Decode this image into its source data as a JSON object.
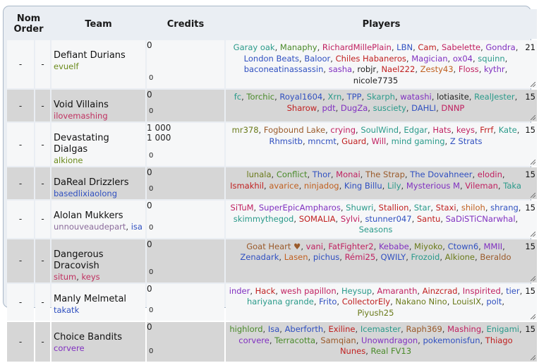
{
  "headers": {
    "nom": "Nom",
    "order": "Order",
    "team": "Team",
    "credits": "Credits",
    "players": "Players"
  },
  "colors": {
    "green": "#4a8a2a",
    "pink": "#c03060",
    "teal": "#2a9a8a",
    "blue": "#3050c0",
    "red": "#c02020",
    "brown": "#9a5a2a",
    "purple": "#8030c0",
    "olive": "#6a7a1a"
  },
  "rows": [
    {
      "nom": "-",
      "order": "-",
      "team": "Defiant Durians",
      "managers": [
        {
          "name": "evuelf",
          "color": "#6a8a1a"
        }
      ],
      "credits": "0",
      "credits_sub": "",
      "credits_left": "0",
      "count": "21",
      "height": 59,
      "players": [
        {
          "n": "Garay oak",
          "c": "#2a9a8a"
        },
        {
          "n": "Manaphy",
          "c": "#4a8a2a"
        },
        {
          "n": "RichardMillePlain",
          "c": "#c02060"
        },
        {
          "n": "LBN",
          "c": "#3050c0"
        },
        {
          "n": "Cam",
          "c": "#c02020"
        },
        {
          "n": "Sabelette",
          "c": "#c02060"
        },
        {
          "n": "Gondra",
          "c": "#8030c0"
        },
        {
          "n": "London Beats",
          "c": "#3050c0"
        },
        {
          "n": "Baloor",
          "c": "#3050c0"
        },
        {
          "n": "Chiles Habaneros",
          "c": "#c02020"
        },
        {
          "n": "Magician",
          "c": "#8030c0"
        },
        {
          "n": "ox04",
          "c": "#8030c0"
        },
        {
          "n": "squinn",
          "c": "#2a9a8a"
        },
        {
          "n": "baconeatinassassin",
          "c": "#3050c0"
        },
        {
          "n": "sasha",
          "c": "#8030c0"
        },
        {
          "n": "robjr",
          "c": "#222222"
        },
        {
          "n": "Nael222",
          "c": "#c02020"
        },
        {
          "n": "Zesty43",
          "c": "#c06020"
        },
        {
          "n": "Floss",
          "c": "#c02060"
        },
        {
          "n": "kythr",
          "c": "#8030c0"
        },
        {
          "n": "nicole7735",
          "c": "#222222"
        }
      ]
    },
    {
      "nom": "-",
      "order": "-",
      "team": "Void Villains",
      "managers": [
        {
          "name": "ilovemashing",
          "color": "#c03060"
        }
      ],
      "credits": "0",
      "credits_sub": "",
      "credits_left": "0",
      "count": "15",
      "height": 37,
      "players": [
        {
          "n": "fc",
          "c": "#2a9a8a"
        },
        {
          "n": "Torchic",
          "c": "#4a8a2a"
        },
        {
          "n": "Royal1604",
          "c": "#3050c0"
        },
        {
          "n": "Xrn",
          "c": "#2a9a8a"
        },
        {
          "n": "TPP",
          "c": "#3050c0"
        },
        {
          "n": "Skarph",
          "c": "#2a9a8a"
        },
        {
          "n": "watashi",
          "c": "#8030c0"
        },
        {
          "n": "lotiasite",
          "c": "#222222"
        },
        {
          "n": "RealJester",
          "c": "#2a9a8a"
        },
        {
          "n": "Sharow",
          "c": "#c02020"
        },
        {
          "n": "pdt",
          "c": "#8030c0"
        },
        {
          "n": "DugZa",
          "c": "#8030c0"
        },
        {
          "n": "susciety",
          "c": "#2a9a8a"
        },
        {
          "n": "DAHLI",
          "c": "#3050c0"
        },
        {
          "n": "DNNP",
          "c": "#c02060"
        }
      ]
    },
    {
      "nom": "-",
      "order": "-",
      "team": "Devastating Dialgas",
      "managers": [
        {
          "name": "alkione",
          "color": "#6a8a1a"
        }
      ],
      "credits": "1 000",
      "credits_sub": "1 000",
      "credits_left": "0",
      "count": "15",
      "height": 41,
      "players": [
        {
          "n": "mr378",
          "c": "#6a7a1a"
        },
        {
          "n": "Fogbound Lake",
          "c": "#9a5a2a"
        },
        {
          "n": "crying",
          "c": "#c02060"
        },
        {
          "n": "SoulWind",
          "c": "#2a9a8a"
        },
        {
          "n": "Edgar",
          "c": "#2a9a8a"
        },
        {
          "n": "Hats",
          "c": "#c02060"
        },
        {
          "n": "keys",
          "c": "#c02060"
        },
        {
          "n": "Frrf",
          "c": "#c02020"
        },
        {
          "n": "Kate",
          "c": "#2a9a8a"
        },
        {
          "n": "Rhmsitb",
          "c": "#3050c0"
        },
        {
          "n": "mncmt",
          "c": "#3050c0"
        },
        {
          "n": "Guard",
          "c": "#c02020"
        },
        {
          "n": "Will",
          "c": "#c02060"
        },
        {
          "n": "mind gaming",
          "c": "#2a9a8a"
        },
        {
          "n": "Z Strats",
          "c": "#3050c0"
        }
      ]
    },
    {
      "nom": "-",
      "order": "-",
      "team": "DaReal Drizzlers",
      "managers": [
        {
          "name": "basedlixiaolong",
          "color": "#3050c0"
        }
      ],
      "credits": "0",
      "credits_sub": "",
      "credits_left": "0",
      "count": "15",
      "height": 42,
      "players": [
        {
          "n": "lunala",
          "c": "#6a7a1a"
        },
        {
          "n": "Conflict",
          "c": "#4a8a2a"
        },
        {
          "n": "Thor",
          "c": "#3050c0"
        },
        {
          "n": "Monai",
          "c": "#c02060"
        },
        {
          "n": "The Strap",
          "c": "#9a5a2a"
        },
        {
          "n": "The Dovahneer",
          "c": "#3050c0"
        },
        {
          "n": "elodin",
          "c": "#c02060"
        },
        {
          "n": "Ismakhil",
          "c": "#c02020"
        },
        {
          "n": "avarice",
          "c": "#c06020"
        },
        {
          "n": "ninjadog",
          "c": "#c06020"
        },
        {
          "n": "King Billu",
          "c": "#3050c0"
        },
        {
          "n": "Lily",
          "c": "#2a9a8a"
        },
        {
          "n": "Mysterious M",
          "c": "#8030c0"
        },
        {
          "n": "Vileman",
          "c": "#c02060"
        },
        {
          "n": "Taka",
          "c": "#2a9a8a"
        }
      ]
    },
    {
      "nom": "-",
      "order": "-",
      "team": "Alolan Mukkers",
      "managers": [
        {
          "name": "unnouveaudepart",
          "color": "#8a6a9a"
        },
        {
          "name": "isa",
          "color": "#3050c0"
        }
      ],
      "credits": "0",
      "credits_sub": "",
      "credits_left": "0",
      "count": "15",
      "height": 43,
      "players": [
        {
          "n": "SiTuM",
          "c": "#c02060"
        },
        {
          "n": "SuperEpicAmpharos",
          "c": "#8030c0"
        },
        {
          "n": "Shuwri",
          "c": "#2a9a8a"
        },
        {
          "n": "Stallion",
          "c": "#c02020"
        },
        {
          "n": "Star",
          "c": "#2a9a8a"
        },
        {
          "n": "Staxi",
          "c": "#c02020"
        },
        {
          "n": "shiloh",
          "c": "#c06020"
        },
        {
          "n": "shrang",
          "c": "#3050c0"
        },
        {
          "n": "skimmythegod",
          "c": "#2a9a8a"
        },
        {
          "n": "SOMALIA",
          "c": "#c02020"
        },
        {
          "n": "Sylvi",
          "c": "#c02060"
        },
        {
          "n": "stunner047",
          "c": "#3050c0"
        },
        {
          "n": "Santu",
          "c": "#c02020"
        },
        {
          "n": "SaDiSTiCNarwhal",
          "c": "#8030c0"
        },
        {
          "n": "Seasons",
          "c": "#2a9a8a"
        }
      ]
    },
    {
      "nom": "-",
      "order": "-",
      "team": "Dangerous Dracovish",
      "managers": [
        {
          "name": "situm",
          "color": "#c03060"
        },
        {
          "name": "keys",
          "color": "#c03060"
        }
      ],
      "credits": "0",
      "credits_sub": "",
      "credits_left": "0",
      "count": "15",
      "height": 43,
      "players": [
        {
          "n": "Goat Heart ♥",
          "c": "#9a5a2a"
        },
        {
          "n": "vani",
          "c": "#c02060"
        },
        {
          "n": "FatFighter2",
          "c": "#c02060"
        },
        {
          "n": "Kebabe",
          "c": "#8030c0"
        },
        {
          "n": "Miyoko",
          "c": "#6a7a1a"
        },
        {
          "n": "Ctown6",
          "c": "#3050c0"
        },
        {
          "n": "MMII",
          "c": "#8030c0"
        },
        {
          "n": "Zenadark",
          "c": "#3050c0"
        },
        {
          "n": "Lasen",
          "c": "#c06020"
        },
        {
          "n": "pichus",
          "c": "#3050c0"
        },
        {
          "n": "Rémi25",
          "c": "#c02060"
        },
        {
          "n": "QWILY",
          "c": "#3050c0"
        },
        {
          "n": "Frozoid",
          "c": "#2a9a8a"
        },
        {
          "n": "Alkione",
          "c": "#6a7a1a"
        },
        {
          "n": "Beraldo",
          "c": "#9a5a2a"
        }
      ]
    },
    {
      "nom": "-",
      "order": "-",
      "team": "Manly Melmetal",
      "managers": [
        {
          "name": "takatk",
          "color": "#3050c0"
        }
      ],
      "credits": "0",
      "credits_sub": "",
      "credits_left": "0",
      "count": "15",
      "height": 43,
      "players": [
        {
          "n": "inder",
          "c": "#8030c0"
        },
        {
          "n": "Hack",
          "c": "#c02020"
        },
        {
          "n": "wesh papillon",
          "c": "#c02060"
        },
        {
          "n": "Heysup",
          "c": "#2a9a8a"
        },
        {
          "n": "Amaranth",
          "c": "#c02060"
        },
        {
          "n": "Ainzcrad",
          "c": "#c02020"
        },
        {
          "n": "Inspirited",
          "c": "#c02060"
        },
        {
          "n": "tier",
          "c": "#3050c0"
        },
        {
          "n": "hariyana grande",
          "c": "#2a9a8a"
        },
        {
          "n": "Frito",
          "c": "#3050c0"
        },
        {
          "n": "CollectorEly",
          "c": "#c02020"
        },
        {
          "n": "Nakano Nino",
          "c": "#6a7a1a"
        },
        {
          "n": "LouisIX",
          "c": "#6a7a1a"
        },
        {
          "n": "polt",
          "c": "#3050c0"
        },
        {
          "n": "Piyush25",
          "c": "#6a7a1a"
        }
      ]
    },
    {
      "nom": "-",
      "order": "-",
      "team": "Choice Bandits",
      "managers": [
        {
          "name": "corvere",
          "color": "#8030c0"
        }
      ],
      "credits": "0",
      "credits_sub": "",
      "credits_left": "0",
      "count": "15",
      "height": 56,
      "players": [
        {
          "n": "highlord",
          "c": "#4a8a2a"
        },
        {
          "n": "Isa",
          "c": "#3050c0"
        },
        {
          "n": "Aberforth",
          "c": "#3050c0"
        },
        {
          "n": "Exiline",
          "c": "#c02020"
        },
        {
          "n": "Icemaster",
          "c": "#2a9a8a"
        },
        {
          "n": "Raph369",
          "c": "#9a5a2a"
        },
        {
          "n": "Mashing",
          "c": "#c02060"
        },
        {
          "n": "Enigami",
          "c": "#2a9a8a"
        },
        {
          "n": "corvere",
          "c": "#8030c0"
        },
        {
          "n": "Terracotta",
          "c": "#4a8a2a"
        },
        {
          "n": "Samqian",
          "c": "#9a5a2a"
        },
        {
          "n": "Unowndragon",
          "c": "#8030c0"
        },
        {
          "n": "pokemonisfun",
          "c": "#3050c0"
        },
        {
          "n": "Thiago Nunes",
          "c": "#c02020"
        },
        {
          "n": "Real FV13",
          "c": "#4a8a2a"
        }
      ]
    }
  ]
}
